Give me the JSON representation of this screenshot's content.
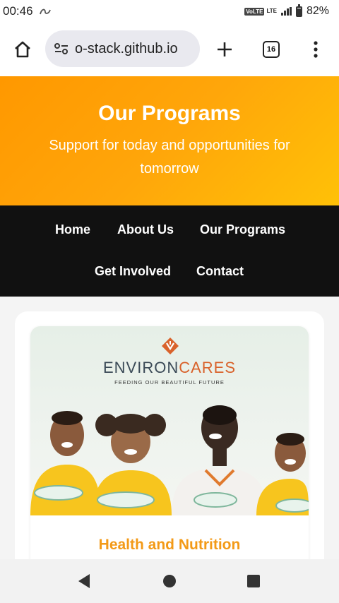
{
  "status_bar": {
    "time": "00:46",
    "notification_icon": "swirl-notification-icon",
    "volte": "VoLTE",
    "lte": "LTE",
    "battery_percent": "82%"
  },
  "browser": {
    "url": "o-stack.github.io",
    "tab_count": "16",
    "icons": [
      "home-icon",
      "site-settings-icon",
      "new-tab-plus-icon",
      "tab-switcher-icon",
      "more-vert-icon"
    ]
  },
  "hero": {
    "title": "Our Programs",
    "subtitle": "Support for today and opportunities for tomorrow"
  },
  "nav": {
    "items": [
      {
        "label": "Home"
      },
      {
        "label": "About Us"
      },
      {
        "label": "Our Programs"
      },
      {
        "label": "Get Involved"
      },
      {
        "label": "Contact"
      }
    ]
  },
  "program": {
    "image": {
      "brand_main": "ENVIRON",
      "brand_accent": "CARES",
      "tagline": "FEEDING OUR BEAUTIFUL FUTURE"
    },
    "title": "Health and Nutrition"
  },
  "colors": {
    "hero_start": "#ff9800",
    "hero_end": "#ffc107",
    "nav_bg": "#111111",
    "accent": "#f39a17"
  }
}
